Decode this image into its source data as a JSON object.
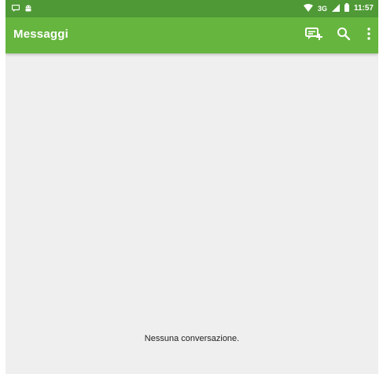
{
  "status_bar": {
    "network": "3G",
    "time": "11:57",
    "left_icons": [
      "notification-icon",
      "android-icon"
    ],
    "right_icons": [
      "wifi-icon",
      "signal-icon",
      "battery-icon"
    ]
  },
  "app_bar": {
    "title": "Messaggi",
    "actions": [
      "new-message-icon",
      "search-icon",
      "more-options-icon"
    ]
  },
  "main": {
    "empty_message": "Nessuna conversazione."
  },
  "colors": {
    "status_bar": "#4f9a36",
    "app_bar": "#66b53f",
    "background": "#efefef",
    "text_on_primary": "#ffffff"
  }
}
